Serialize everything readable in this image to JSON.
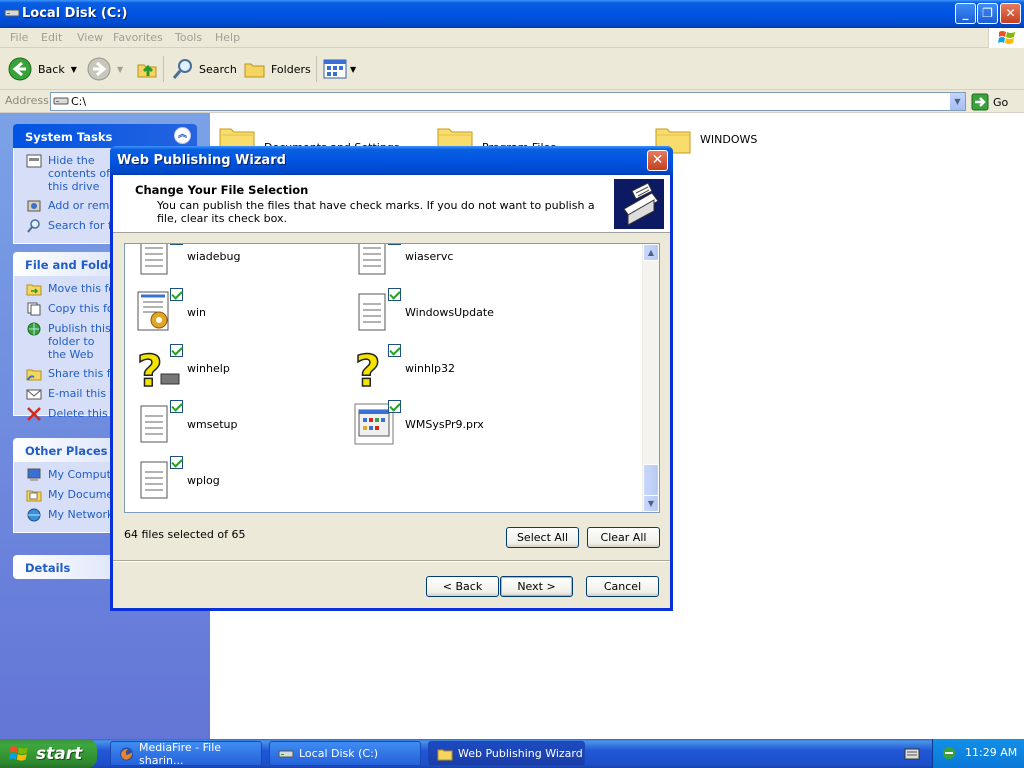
{
  "window": {
    "title": "Local Disk (C:)"
  },
  "menu": [
    "File",
    "Edit",
    "View",
    "Favorites",
    "Tools",
    "Help"
  ],
  "toolbar": {
    "back": "Back",
    "search": "Search",
    "folders": "Folders"
  },
  "address": {
    "label": "Address",
    "value": "C:\\",
    "go": "Go"
  },
  "sidebar": {
    "system_tasks": {
      "title": "System Tasks",
      "items": [
        "Hide the contents of this drive",
        "Add or remove programs",
        "Search for files or folders"
      ]
    },
    "file_folder_tasks": {
      "title": "File and Folder Tasks",
      "items": [
        "Move this folder",
        "Copy this folder",
        "Publish this folder to the Web",
        "Share this folder",
        "E-mail this folder's files",
        "Delete this folder"
      ]
    },
    "other_places": {
      "title": "Other Places",
      "items": [
        "My Computer",
        "My Documents",
        "My Network Places"
      ]
    },
    "details": {
      "title": "Details"
    }
  },
  "content": {
    "folders": [
      "Documents and Settings",
      "Program Files",
      "WINDOWS"
    ]
  },
  "wizard": {
    "title": "Web Publishing Wizard",
    "header_title": "Change Your File Selection",
    "header_subtitle": "You can publish the files that have check marks.  If you do not want to publish a file, clear its check box.",
    "files": [
      {
        "name": "wiadebug",
        "icon": "notepad-icon",
        "checked": true
      },
      {
        "name": "wiaservc",
        "icon": "notepad-icon",
        "checked": true
      },
      {
        "name": "win",
        "icon": "ini-settings-icon",
        "checked": true
      },
      {
        "name": "WindowsUpdate",
        "icon": "notepad-icon",
        "checked": true
      },
      {
        "name": "winhelp",
        "icon": "help-icon",
        "checked": true
      },
      {
        "name": "winhlp32",
        "icon": "help-icon",
        "checked": true
      },
      {
        "name": "wmsetup",
        "icon": "notepad-icon",
        "checked": true
      },
      {
        "name": "WMSysPr9.prx",
        "icon": "app-window-icon",
        "checked": true
      },
      {
        "name": "wplog",
        "icon": "notepad-icon",
        "checked": true
      }
    ],
    "selected_count": "64 files selected of 65",
    "buttons": {
      "select_all": "Select All",
      "clear_all": "Clear All",
      "back": "< Back",
      "next": "Next >",
      "cancel": "Cancel"
    }
  },
  "taskbar": {
    "start": "start",
    "tasks": [
      "MediaFire - File sharin...",
      "Local Disk (C:)",
      "Web Publishing Wizard"
    ],
    "clock": "11:29 AM"
  }
}
